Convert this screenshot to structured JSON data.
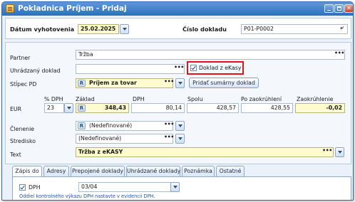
{
  "window": {
    "title": "Pokladnica Príjem - Pridaj",
    "minimize": "minimize",
    "maximize": "maximize",
    "close": "✕"
  },
  "header": {
    "date_label": "Dátum vyhotovenia",
    "date_value": "25.02.2025",
    "docnum_label": "Číslo dokladu",
    "docnum_value": "P01-P0002",
    "docnum_btn": "⤶"
  },
  "form": {
    "partner_label": "Partner",
    "partner_value": "Tržba",
    "paid_doc_label": "Uhrádzaný doklad",
    "paid_doc_value": "",
    "ekasy_label": "Doklad z eKasy",
    "ekasy_checked": true,
    "column_label": "Stĺpec PD",
    "column_badge": "R",
    "column_value": "Príjem za tovar",
    "summary_button": "Pridať sumárny doklad",
    "amounts": {
      "currency": "EUR",
      "vat_pct_label": "% DPH",
      "vat_pct_value": "23",
      "base_label": "Základ",
      "base_badge": "R",
      "base_value": "348,43",
      "vat_label": "DPH",
      "vat_value": "80,14",
      "total_label": "Spolu",
      "total_value": "428,57",
      "after_round_label": "Po zaokrúhlení",
      "after_round_value": "428,55",
      "rounding_label": "Zaokrúhlenie",
      "rounding_value": "-0,02"
    },
    "division_label": "Členenie",
    "division_badge": "R",
    "division_value": "(Nedefinované)",
    "center_label": "Stredisko",
    "center_value": "(Nedefinované)",
    "text_label": "Text",
    "text_value": "Tržba z eKASY"
  },
  "tabs": [
    {
      "label": "Zápis do",
      "active": true
    },
    {
      "label": "Adresy",
      "active": false
    },
    {
      "label": "Prepojené doklady",
      "active": false
    },
    {
      "label": "Uhrádzané doklady",
      "active": false
    },
    {
      "label": "Poznámka",
      "active": false
    },
    {
      "label": "Ostatné",
      "active": false
    }
  ],
  "tab_content": {
    "dph_checked": true,
    "dph_label": "DPH",
    "dph_value": "03/04",
    "hint": "Oddiel kontrolného výkazu DPH nastavte v evidencii DPH."
  },
  "colors": {
    "titlebar": "#2f6fbd",
    "highlight": "#e0131a",
    "yellow_field": "#fffbd0",
    "hint_text": "#2255b0"
  },
  "icons": {
    "app": "cash-register-icon",
    "dropdown": "chevron-down-icon",
    "lookup": "ellipsis-icon",
    "check": "check-icon"
  }
}
